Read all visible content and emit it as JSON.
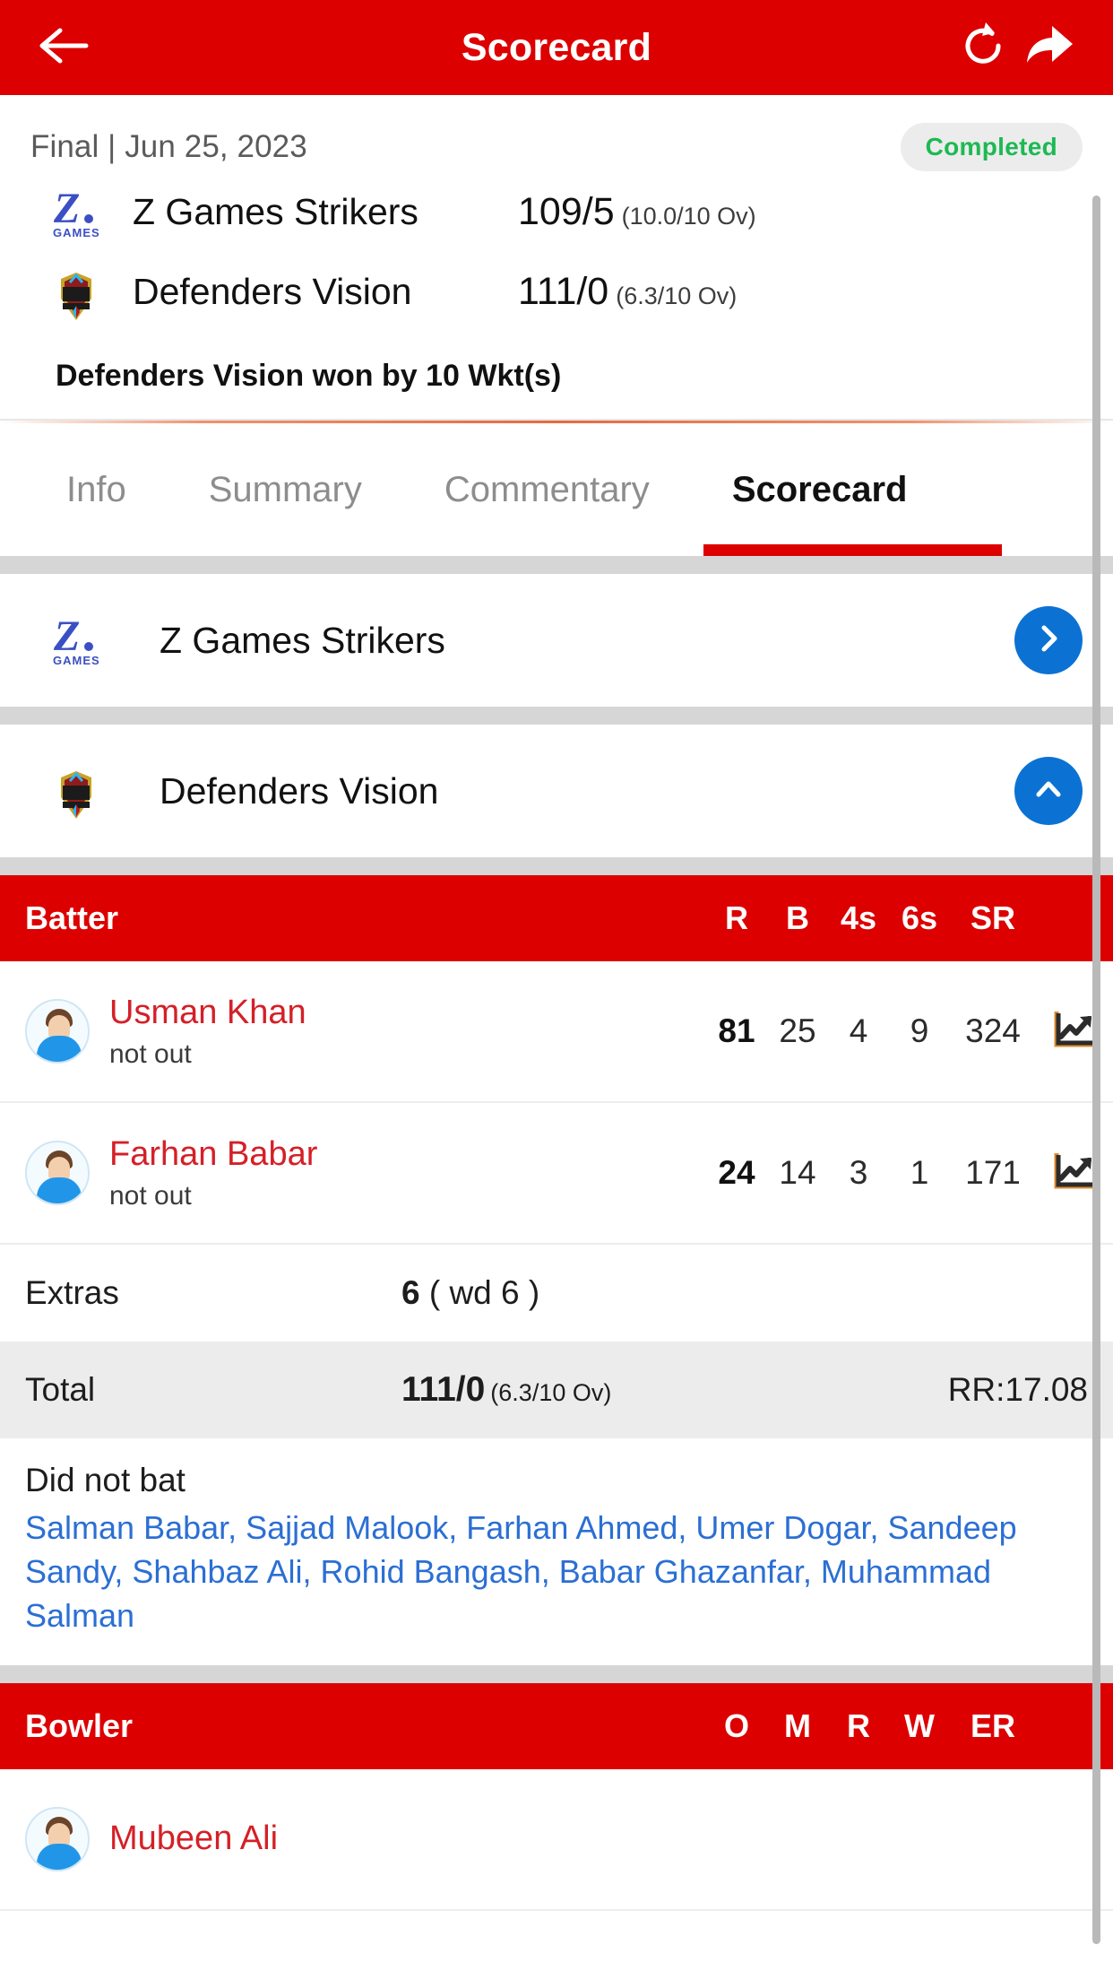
{
  "header": {
    "back_icon": "back-arrow-icon",
    "title": "Scorecard",
    "refresh_icon": "refresh-icon",
    "share_icon": "share-icon"
  },
  "match": {
    "stage_and_date": "Final | Jun 25, 2023",
    "status": "Completed",
    "teams": [
      {
        "name": "Z Games Strikers",
        "score": "109/5",
        "overs": "(10.0/10 Ov)",
        "logo": "z-games-strikers-logo"
      },
      {
        "name": "Defenders Vision",
        "score": "111/0",
        "overs": "(6.3/10 Ov)",
        "logo": "defenders-vision-logo"
      }
    ],
    "result": "Defenders Vision won by 10 Wkt(s)"
  },
  "tabs": [
    {
      "label": "Info",
      "active": false
    },
    {
      "label": "Summary",
      "active": false
    },
    {
      "label": "Commentary",
      "active": false
    },
    {
      "label": "Scorecard",
      "active": true
    }
  ],
  "innings": [
    {
      "team": "Z Games Strikers",
      "expanded": false,
      "toggle_icon": "chevron-right-icon"
    },
    {
      "team": "Defenders Vision",
      "expanded": true,
      "toggle_icon": "chevron-up-icon"
    }
  ],
  "batting": {
    "headers": {
      "name": "Batter",
      "r": "R",
      "b": "B",
      "fours": "4s",
      "sixes": "6s",
      "sr": "SR"
    },
    "rows": [
      {
        "name": "Usman Khan",
        "dismissal": "not out",
        "r": "81",
        "b": "25",
        "fours": "4",
        "sixes": "9",
        "sr": "324",
        "chart_icon": "line-chart-icon"
      },
      {
        "name": "Farhan Babar",
        "dismissal": "not out",
        "r": "24",
        "b": "14",
        "fours": "3",
        "sixes": "1",
        "sr": "171",
        "chart_icon": "line-chart-icon"
      }
    ],
    "extras": {
      "label": "Extras",
      "value": "6",
      "detail": "( wd 6 )"
    },
    "total": {
      "label": "Total",
      "value": "111/0",
      "overs": "(6.3/10 Ov)",
      "run_rate": "RR:17.08"
    },
    "did_not_bat": {
      "label": "Did not bat",
      "names": "Salman Babar, Sajjad Malook, Farhan Ahmed, Umer Dogar, Sandeep Sandy, Shahbaz Ali, Rohid Bangash, Babar Ghazanfar, Muhammad Salman"
    }
  },
  "bowling": {
    "headers": {
      "name": "Bowler",
      "o": "O",
      "m": "M",
      "r": "R",
      "w": "W",
      "er": "ER"
    },
    "rows": [
      {
        "name": "Mubeen Ali"
      }
    ]
  },
  "colors": {
    "brand_red": "#dd0000",
    "accent_blue": "#0b72d4",
    "player_red": "#d42027",
    "link_blue": "#2b6fd4",
    "status_green": "#1db954"
  }
}
